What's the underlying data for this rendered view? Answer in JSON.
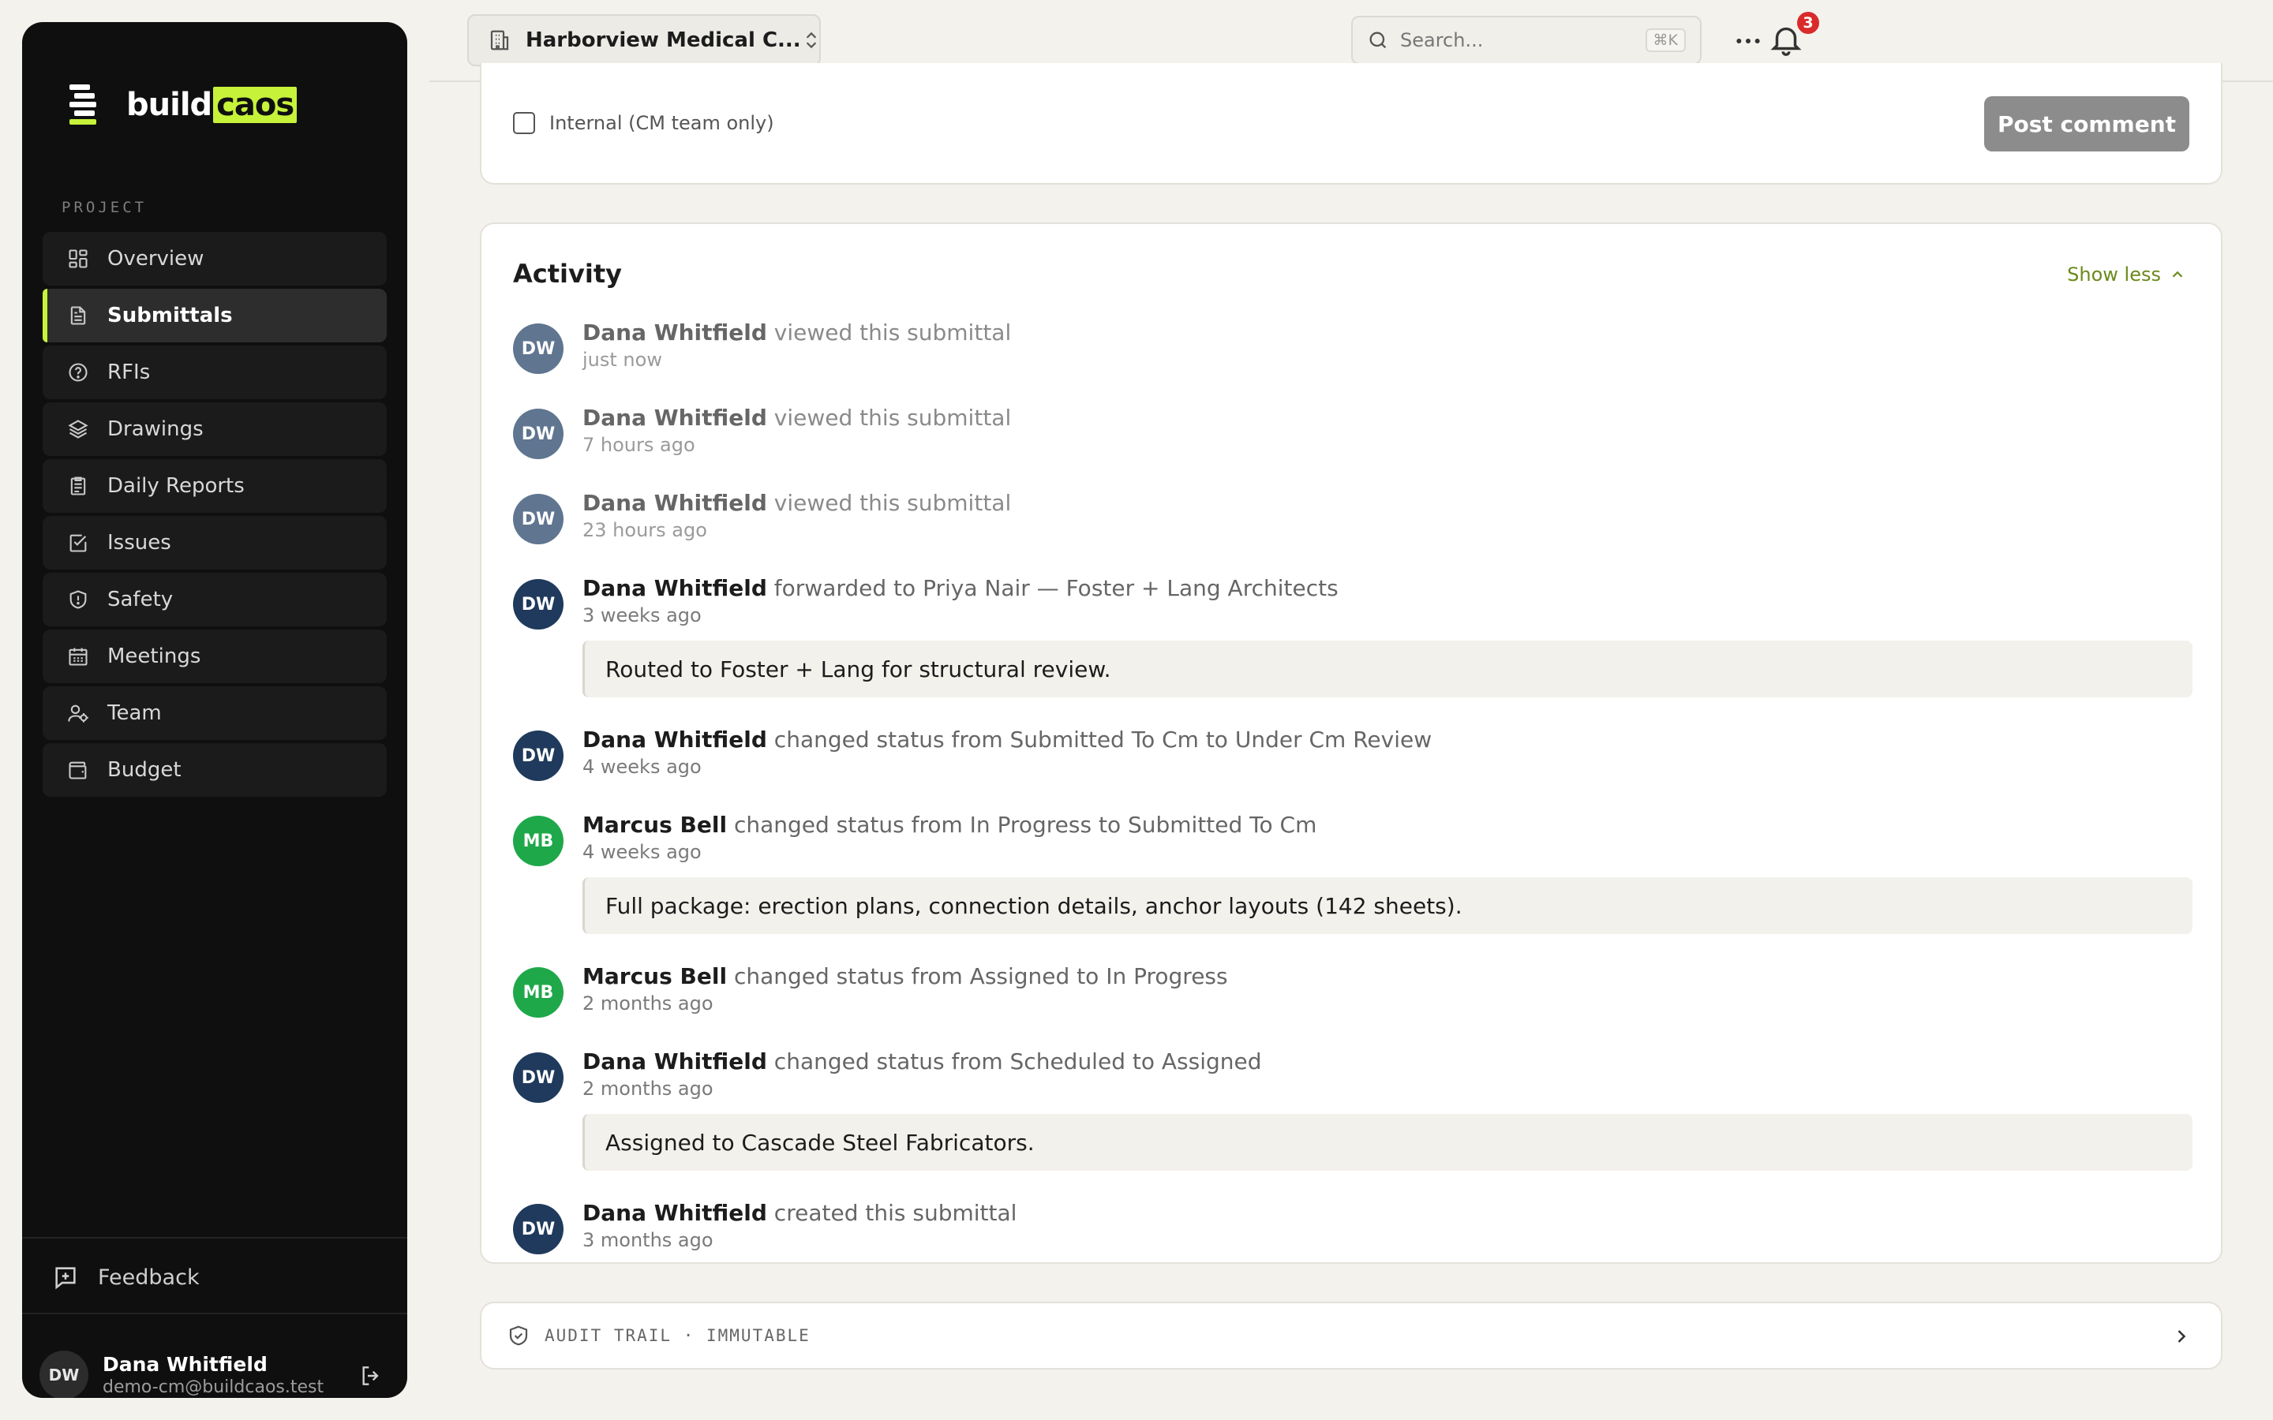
{
  "brand": {
    "logo_word": "build",
    "logo_highlight": "caos",
    "accent": "#c6f23a"
  },
  "sidebar": {
    "section_label": "PROJECT",
    "items": [
      {
        "label": "Overview",
        "icon": "grid-icon",
        "active": false
      },
      {
        "label": "Submittals",
        "icon": "document-icon",
        "active": true
      },
      {
        "label": "RFIs",
        "icon": "question-icon",
        "active": false
      },
      {
        "label": "Drawings",
        "icon": "layers-icon",
        "active": false
      },
      {
        "label": "Daily Reports",
        "icon": "clipboard-icon",
        "active": false
      },
      {
        "label": "Issues",
        "icon": "checkbox-icon",
        "active": false
      },
      {
        "label": "Safety",
        "icon": "shield-icon",
        "active": false
      },
      {
        "label": "Meetings",
        "icon": "calendar-icon",
        "active": false
      },
      {
        "label": "Team",
        "icon": "team-icon",
        "active": false
      },
      {
        "label": "Budget",
        "icon": "wallet-icon",
        "active": false
      }
    ],
    "feedback_label": "Feedback",
    "user": {
      "initials": "DW",
      "name": "Dana Whitfield",
      "email": "demo-cm@buildcaos.test"
    }
  },
  "topbar": {
    "project_name": "Harborview Medical C...",
    "search_placeholder": "Search...",
    "search_shortcut": "⌘K",
    "notification_count": "3"
  },
  "comment": {
    "internal_label": "Internal (CM team only)",
    "post_label": "Post comment"
  },
  "activity": {
    "title": "Activity",
    "toggle_label": "Show less",
    "entries": [
      {
        "initials": "DW",
        "who": "Dana Whitfield",
        "action": " viewed this submittal",
        "time": "just now",
        "faded": true,
        "note": ""
      },
      {
        "initials": "DW",
        "who": "Dana Whitfield",
        "action": " viewed this submittal",
        "time": "7 hours ago",
        "faded": true,
        "note": ""
      },
      {
        "initials": "DW",
        "who": "Dana Whitfield",
        "action": " viewed this submittal",
        "time": "23 hours ago",
        "faded": true,
        "note": ""
      },
      {
        "initials": "DW",
        "who": "Dana Whitfield",
        "action": " forwarded to Priya Nair — Foster + Lang Architects",
        "time": "3 weeks ago",
        "faded": false,
        "note": "Routed to Foster + Lang for structural review."
      },
      {
        "initials": "DW",
        "who": "Dana Whitfield",
        "action": " changed status from Submitted To Cm to Under Cm Review",
        "time": "4 weeks ago",
        "faded": false,
        "note": ""
      },
      {
        "initials": "MB",
        "who": "Marcus Bell",
        "action": " changed status from In Progress to Submitted To Cm",
        "time": "4 weeks ago",
        "faded": false,
        "note": "Full package: erection plans, connection details, anchor layouts (142 sheets)."
      },
      {
        "initials": "MB",
        "who": "Marcus Bell",
        "action": " changed status from Assigned to In Progress",
        "time": "2 months ago",
        "faded": false,
        "note": ""
      },
      {
        "initials": "DW",
        "who": "Dana Whitfield",
        "action": " changed status from Scheduled to Assigned",
        "time": "2 months ago",
        "faded": false,
        "note": "Assigned to Cascade Steel Fabricators."
      },
      {
        "initials": "DW",
        "who": "Dana Whitfield",
        "action": " created this submittal",
        "time": "3 months ago",
        "faded": false,
        "note": ""
      }
    ]
  },
  "audit": {
    "label": "AUDIT TRAIL · IMMUTABLE"
  },
  "colors": {
    "avatar_dw": "#1f3a5c",
    "avatar_dw_faded": "#5f7590",
    "avatar_mb": "#1fa84a"
  }
}
